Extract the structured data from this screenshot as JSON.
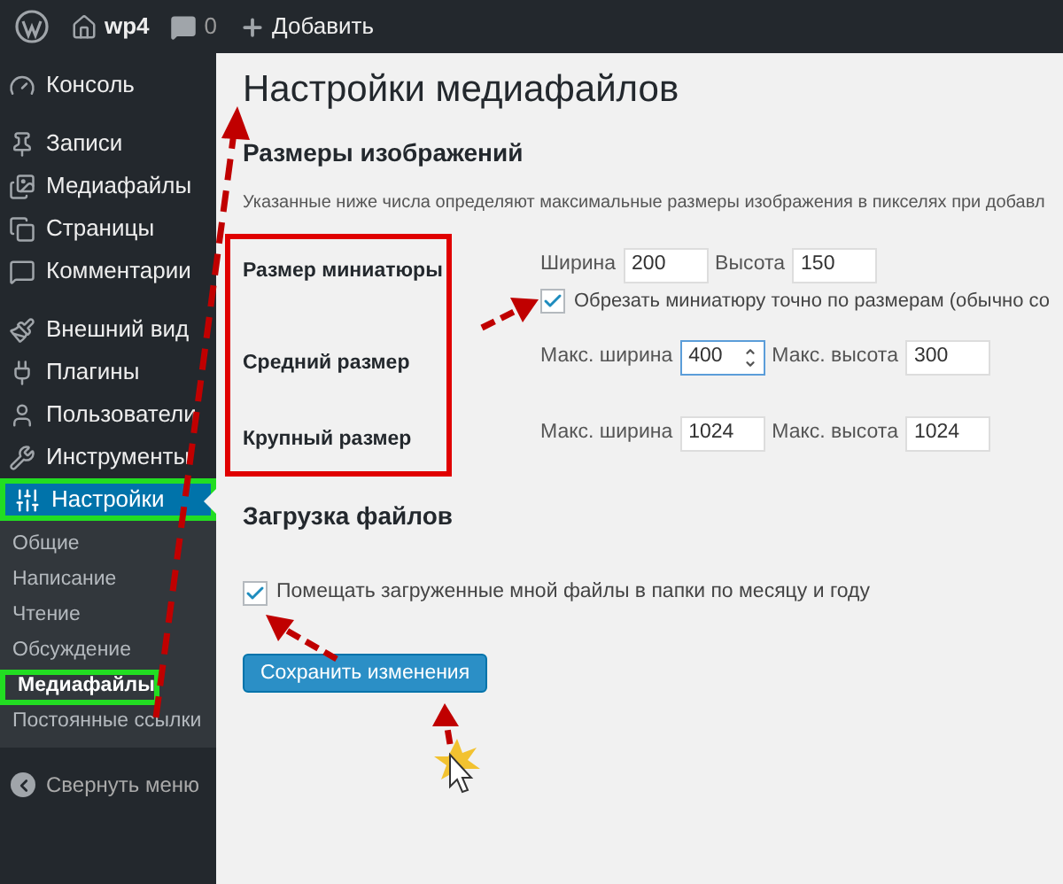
{
  "admin_bar": {
    "site": "wp4",
    "comments": "0",
    "new": "Добавить"
  },
  "sidebar": {
    "groups": [
      [
        {
          "label": "Консоль",
          "selected": false,
          "annotated": false
        }
      ],
      [
        {
          "label": "Записи",
          "selected": false,
          "annotated": false
        },
        {
          "label": "Медиафайлы",
          "selected": false,
          "annotated": false
        },
        {
          "label": "Страницы",
          "selected": false,
          "annotated": false
        },
        {
          "label": "Комментарии",
          "selected": false,
          "annotated": false
        }
      ],
      [
        {
          "label": "Внешний вид",
          "selected": false,
          "annotated": false
        },
        {
          "label": "Плагины",
          "selected": false,
          "annotated": false
        },
        {
          "label": "Пользователи",
          "selected": false,
          "annotated": false
        },
        {
          "label": "Инструменты",
          "selected": false,
          "annotated": false
        },
        {
          "label": "Настройки",
          "selected": true,
          "annotated": true
        }
      ]
    ],
    "submenu": [
      {
        "label": "Общие",
        "selected": false,
        "annotated": false
      },
      {
        "label": "Написание",
        "selected": false,
        "annotated": false
      },
      {
        "label": "Чтение",
        "selected": false,
        "annotated": false
      },
      {
        "label": "Обсуждение",
        "selected": false,
        "annotated": false
      },
      {
        "label": "Медиафайлы",
        "selected": true,
        "annotated": true
      },
      {
        "label": "Постоянные ссылки",
        "selected": false,
        "annotated": false
      }
    ],
    "collapse": "Свернуть меню"
  },
  "page": {
    "title": "Настройки медиафайлов",
    "image_sizes": {
      "heading": "Размеры изображений",
      "description": "Указанные ниже числа определяют максимальные размеры изображения в пикселях при добавл",
      "rows": [
        {
          "label": "Размер миниатюры",
          "fields": [
            {
              "label": "Ширина",
              "value": "200",
              "focused": false
            },
            {
              "label": "Высота",
              "value": "150",
              "focused": false
            }
          ],
          "crop": {
            "label": "Обрезать миниатюру точно по размерам (обычно со",
            "checked": true
          }
        },
        {
          "label": "Средний размер",
          "fields": [
            {
              "label": "Макс. ширина",
              "value": "400",
              "focused": true
            },
            {
              "label": "Макс. высота",
              "value": "300",
              "focused": false
            }
          ]
        },
        {
          "label": "Крупный размер",
          "fields": [
            {
              "label": "Макс. ширина",
              "value": "1024",
              "focused": false
            },
            {
              "label": "Макс. высота",
              "value": "1024",
              "focused": false
            }
          ]
        }
      ]
    },
    "uploads": {
      "heading": "Загрузка файлов",
      "option": {
        "label": "Помещать загруженные мной файлы в папки по месяцу и году",
        "checked": true
      }
    },
    "save_button": "Сохранить изменения"
  }
}
